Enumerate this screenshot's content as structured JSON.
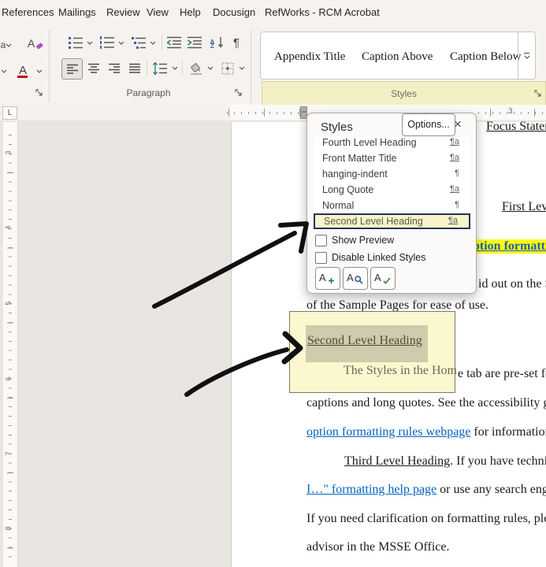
{
  "menu": {
    "items": [
      "References",
      "Mailings",
      "Review",
      "View",
      "Help",
      "Docusign",
      "RefWorks - RCM",
      "Acrobat"
    ]
  },
  "ribbon": {
    "font_group": {
      "font_color_letter": "A",
      "clear_format_letter": "A",
      "case_letter": "a"
    },
    "paragraph_group": {
      "label": "Paragraph",
      "pilcrow": "¶",
      "sort_a": "A",
      "sort_z": "Z"
    },
    "styles_gallery": {
      "items": [
        "Appendix Title",
        "Caption Above",
        "Caption Below"
      ]
    },
    "styles_band": {
      "label": "Styles"
    }
  },
  "rulers": {
    "tab_selector": "L",
    "h_number": "3",
    "v_numbers": [
      "3",
      "4",
      "5",
      "6",
      "7",
      "8"
    ]
  },
  "styles_pane": {
    "title": "Styles",
    "close_glyph": "×",
    "items": [
      {
        "label": "Fourth Level Heading",
        "badge": "¶a"
      },
      {
        "label": "Front Matter Title",
        "badge": "¶a"
      },
      {
        "label": "hanging-indent",
        "badge": "¶"
      },
      {
        "label": "Long Quote",
        "badge": "¶a"
      },
      {
        "label": "Normal",
        "badge": "¶"
      },
      {
        "label": "Second Level Heading",
        "badge": "¶a"
      }
    ],
    "show_preview": "Show Preview",
    "disable_linked": "Disable Linked Styles",
    "options": "Options...",
    "new_style_letter": "A",
    "inspector_letter": "A",
    "manage_letter": "A"
  },
  "document": {
    "focus_heading": "Focus Statement",
    "first_level_heading": "First Level Heading",
    "caption_fragment": "ption formatting ru",
    "laid_fragment": "id out on the Sample",
    "sample_line": "of the Sample Pages for ease of use.",
    "preset_fragment": "e tab are pre-set fo",
    "captions_line": "captions and long quotes. See the accessibility gui",
    "option_link": "option formatting rules webpage",
    "option_rest": " for information o",
    "third_heading": "Third Level Heading",
    "third_rest": ". If you have technica",
    "help_link": "I…\" formatting help page",
    "help_rest": " or use any search engi",
    "clarify_line": "If you need clarification on formatting rules, plea",
    "advisor_line": "advisor in the MSSE Office."
  },
  "callout": {
    "heading": "Second Level Heading",
    "body": "The Styles in the Hom"
  },
  "colors": {
    "accent_blue": "#2b579a",
    "link_blue": "#0563c1",
    "highlight_yellow": "#ffff00",
    "band_yellow": "#f3f0c6",
    "callout_yellow": "#fbf8d0",
    "selection_olive": "#cfcbab",
    "selected_border_navy": "#17365d"
  }
}
